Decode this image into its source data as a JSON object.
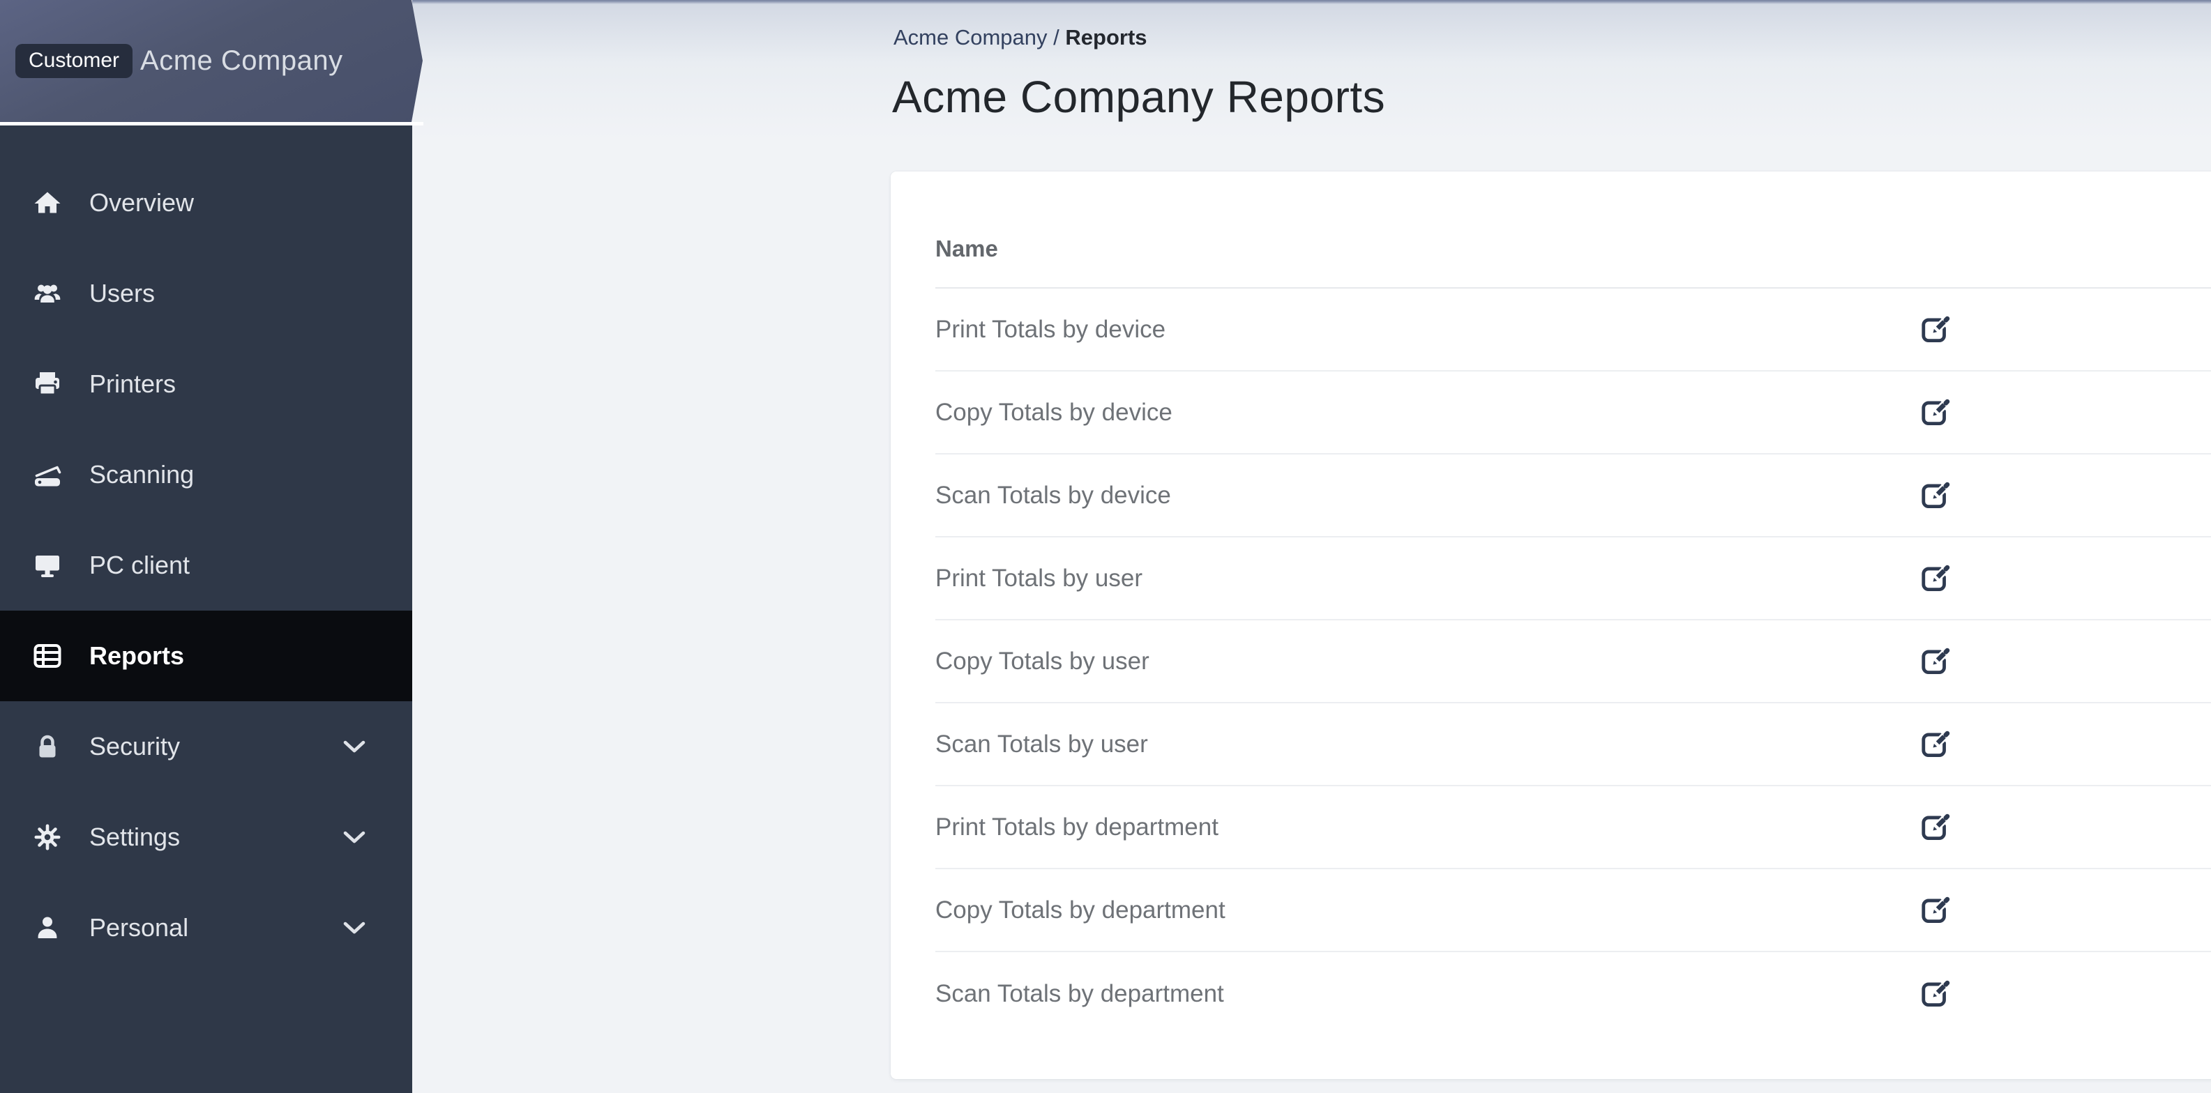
{
  "colors": {
    "sidebar_bg": "#2f3848",
    "sidebar_active_bg": "#0a0c10",
    "header_gradient_start": "#5c6484",
    "header_gradient_end": "#474f6a",
    "badge_bg": "#262d3d",
    "page_bg": "#f1f3f6",
    "breadcrumb_link": "#33415f",
    "title_color": "#23272c",
    "edit_icon": "#2e3a50"
  },
  "brand": {
    "badge_label": "Customer",
    "company_name": "Acme Company"
  },
  "sidebar": {
    "items": [
      {
        "label": "Overview",
        "icon": "home-icon",
        "active": false,
        "expandable": false
      },
      {
        "label": "Users",
        "icon": "users-icon",
        "active": false,
        "expandable": false
      },
      {
        "label": "Printers",
        "icon": "printer-icon",
        "active": false,
        "expandable": false
      },
      {
        "label": "Scanning",
        "icon": "scanner-icon",
        "active": false,
        "expandable": false
      },
      {
        "label": "PC client",
        "icon": "desktop-icon",
        "active": false,
        "expandable": false
      },
      {
        "label": "Reports",
        "icon": "table-list-icon",
        "active": true,
        "expandable": false
      },
      {
        "label": "Security",
        "icon": "lock-icon",
        "active": false,
        "expandable": true
      },
      {
        "label": "Settings",
        "icon": "gear-icon",
        "active": false,
        "expandable": true
      },
      {
        "label": "Personal",
        "icon": "person-icon",
        "active": false,
        "expandable": true
      }
    ]
  },
  "breadcrumb": {
    "parent": "Acme Company",
    "separator": "/",
    "current": "Reports"
  },
  "page": {
    "title": "Acme Company Reports"
  },
  "reports_table": {
    "columns": [
      {
        "label": "Name"
      }
    ],
    "action_icon": "edit-icon",
    "rows": [
      {
        "name": "Print Totals by device"
      },
      {
        "name": "Copy Totals by device"
      },
      {
        "name": "Scan Totals by device"
      },
      {
        "name": "Print Totals by user"
      },
      {
        "name": "Copy Totals by user"
      },
      {
        "name": "Scan Totals by user"
      },
      {
        "name": "Print Totals by department"
      },
      {
        "name": "Copy Totals by department"
      },
      {
        "name": "Scan Totals by department"
      }
    ]
  }
}
